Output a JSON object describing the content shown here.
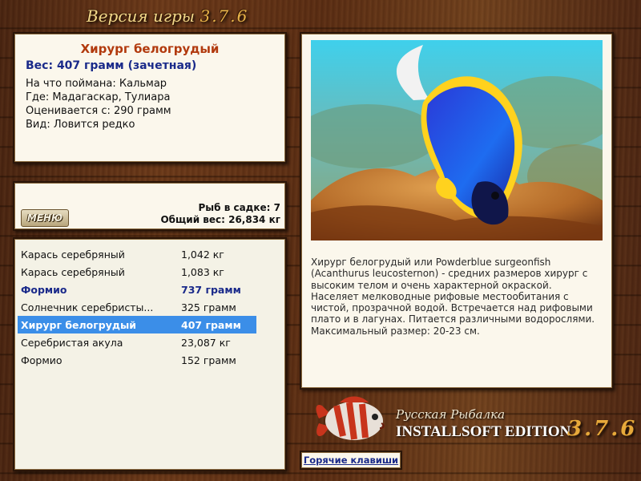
{
  "header": {
    "version_label": "Версия игры",
    "version_number": "3.7.6"
  },
  "fish_info": {
    "name": "Хирург белогрудый",
    "weight_line": "Вес: 407 грамм (зачетная)",
    "lines": [
      "На что поймана: Кальмар",
      "Где: Мадагаскар, Тулиара",
      "Оценивается с: 290 грамм",
      "Вид: Ловится редко"
    ]
  },
  "keepnet": {
    "menu_label": "МЕНЮ",
    "count_line": "Рыб в садке: 7",
    "total_line": "Общий вес: 26,834 кг"
  },
  "catch_list": [
    {
      "name": "Карась серебряный",
      "weight": "1,042 кг",
      "style": "normal"
    },
    {
      "name": "Карась серебряный",
      "weight": "1,083 кг",
      "style": "normal"
    },
    {
      "name": "Формио",
      "weight": "737 грамм",
      "style": "bold"
    },
    {
      "name": "Солнечник серебристы...",
      "weight": "325 грамм",
      "style": "normal"
    },
    {
      "name": "Хирург белогрудый",
      "weight": "407 грамм",
      "style": "selected"
    },
    {
      "name": "Серебристая акула",
      "weight": "23,087 кг",
      "style": "normal"
    },
    {
      "name": "Формио",
      "weight": "152 грамм",
      "style": "normal"
    }
  ],
  "description": "Хирург белогрудый или Powderblue surgeonfish (Acanthurus leucosternon) - средних размеров хирург с высоким телом и очень характерной окраской. Населяет мелководные рифовые местообитания с чистой, прозрачной водой. Встречается над рифовыми плато и в лагунах. Питается различными водорослями. Максимальный размер: 20-23 см.",
  "logo": {
    "line1": "Русская Рыбалка",
    "line2": "INSTALLSOFT EDITION",
    "version": "3.7.6"
  },
  "footer": {
    "hotkeys_label": "Горячие клавиши"
  },
  "colors": {
    "fish_name": "#b23a0e",
    "weight_blue": "#1a2a8a",
    "selection": "#3b8ee8",
    "panel_bg": "#fbf7ec",
    "wood": "#5a2c12"
  }
}
